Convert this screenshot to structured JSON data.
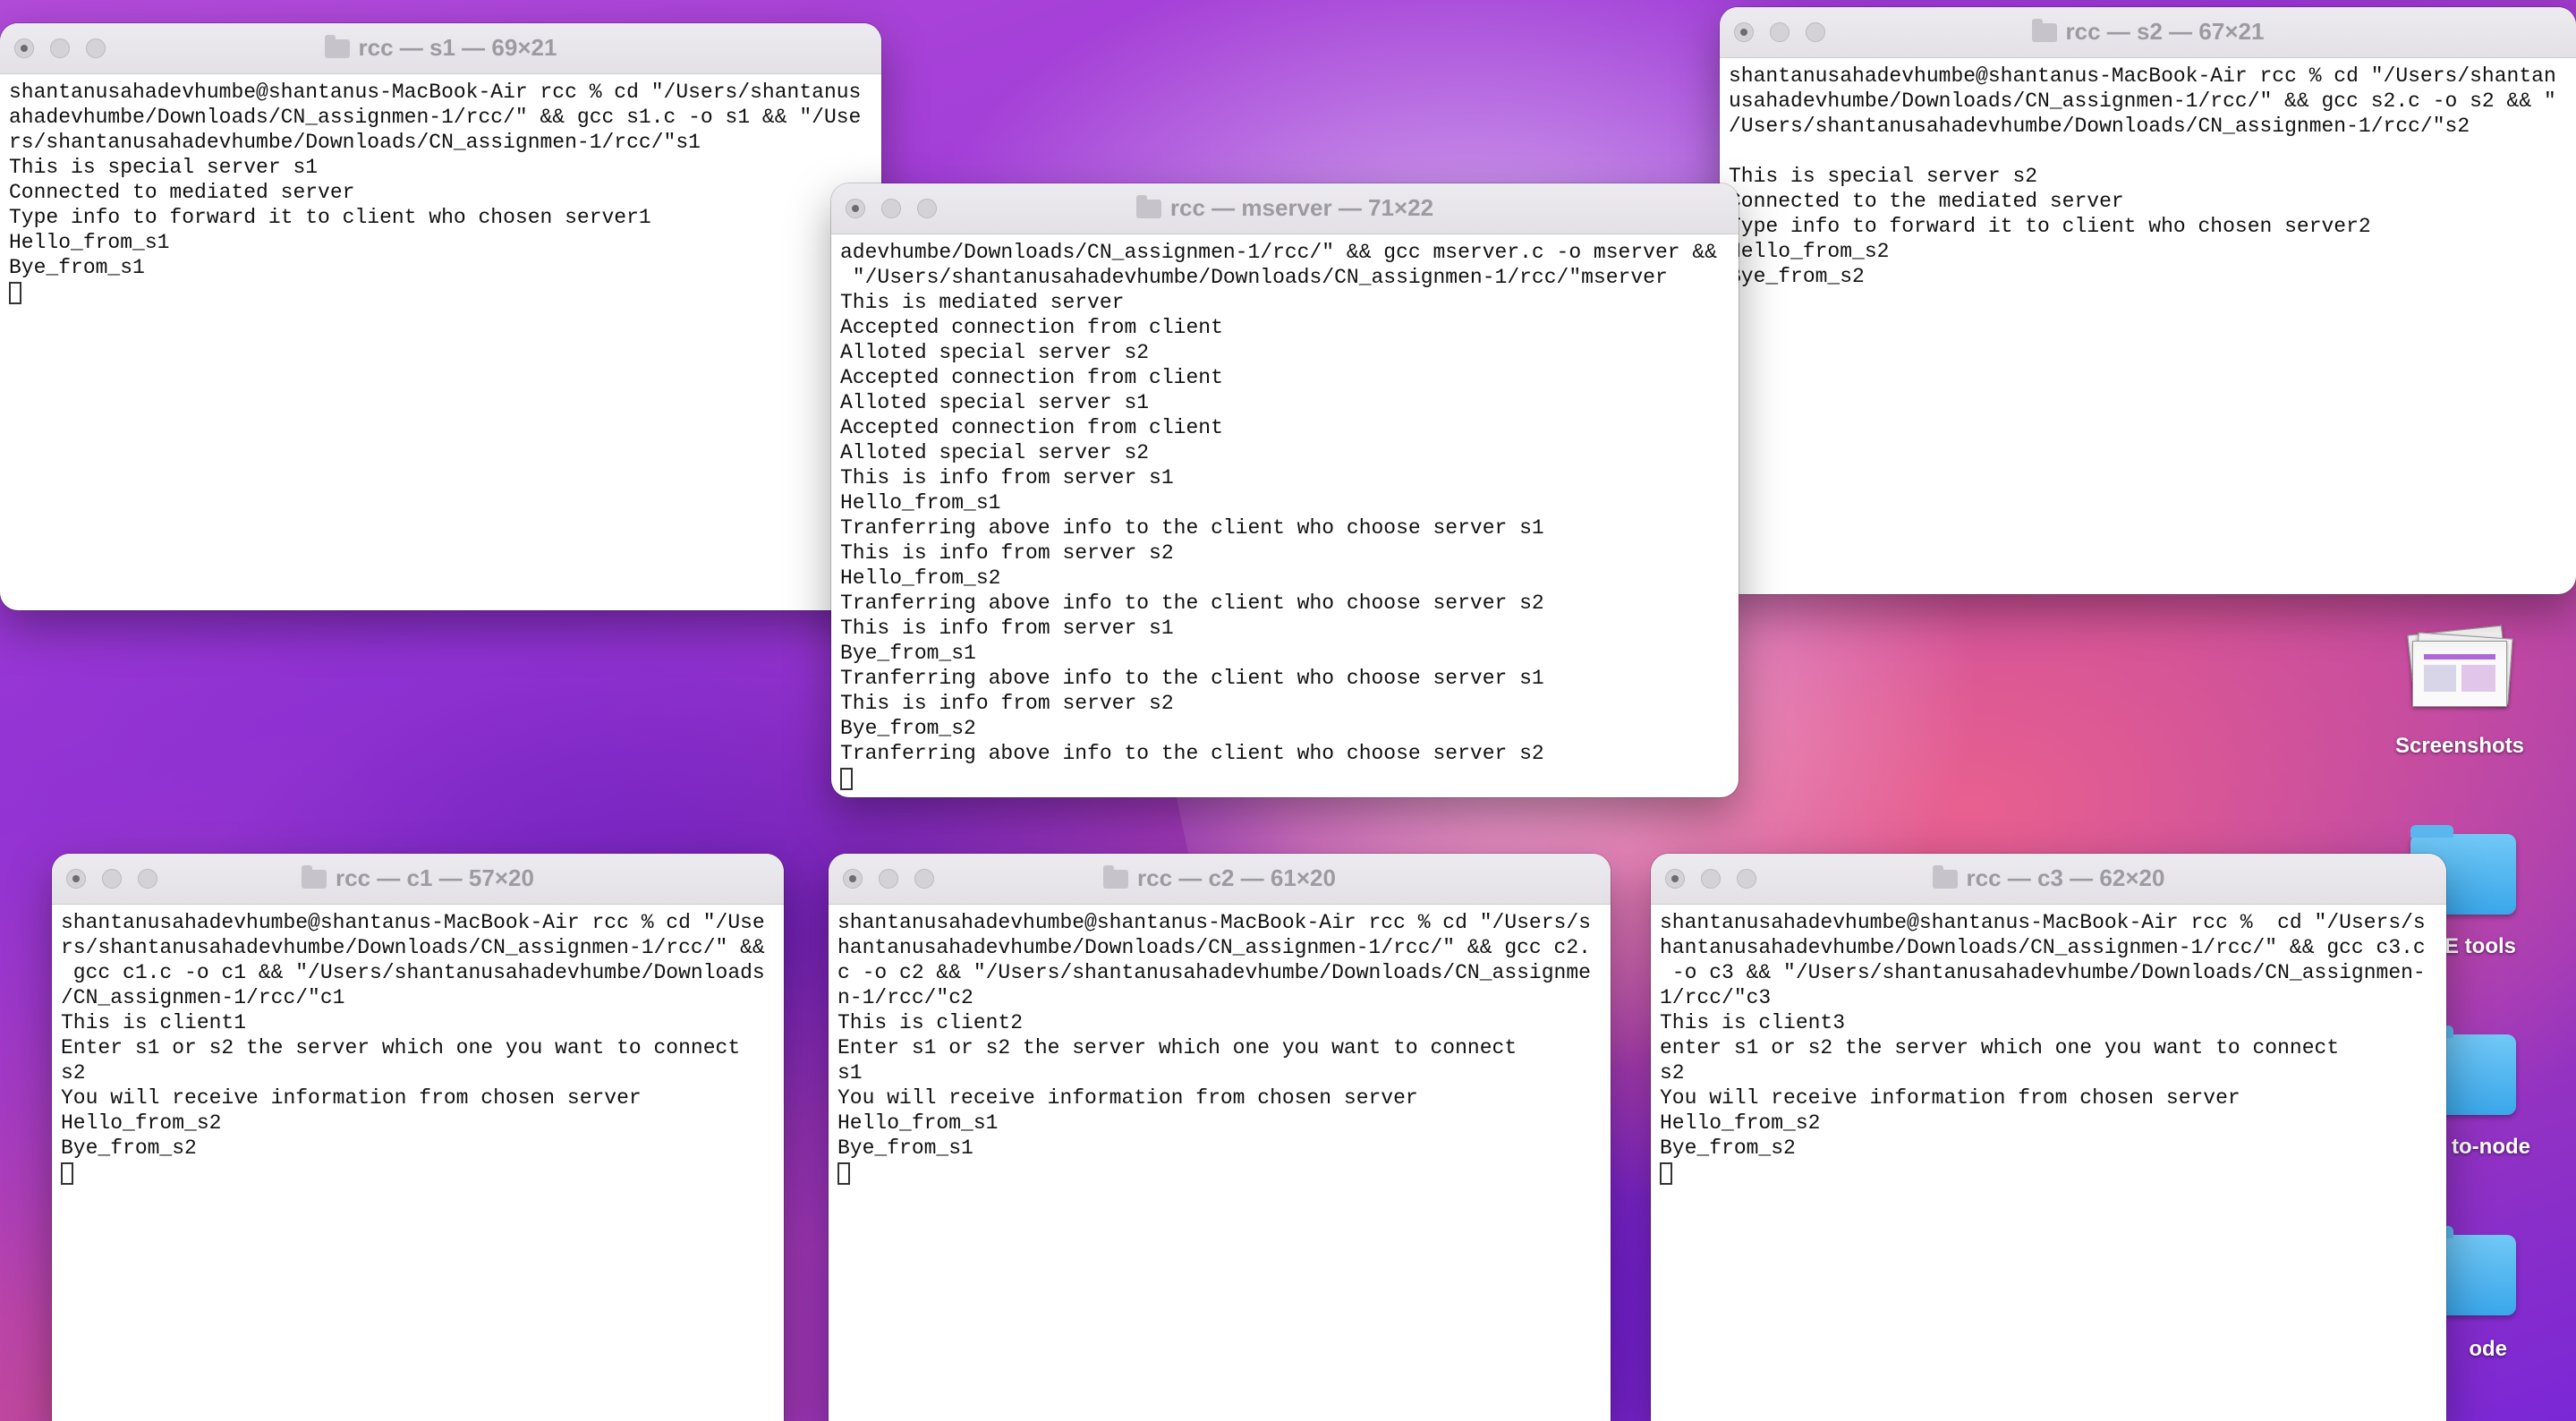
{
  "desktop": {
    "items": [
      {
        "label": "Screenshots"
      },
      {
        "label": "E tools"
      },
      {
        "label": "to-node"
      },
      {
        "label": "ode"
      }
    ]
  },
  "windows": {
    "s1": {
      "title": "rcc — s1 — 69×21",
      "text": "shantanusahadevhumbe@shantanus-MacBook-Air rcc % cd \"/Users/shantanus\nahadevhumbe/Downloads/CN_assignmen-1/rcc/\" && gcc s1.c -o s1 && \"/Use\nrs/shantanusahadevhumbe/Downloads/CN_assignmen-1/rcc/\"s1\nThis is special server s1\nConnected to mediated server\nType info to forward it to client who chosen server1\nHello_from_s1\nBye_from_s1"
    },
    "s2": {
      "title": "rcc — s2 — 67×21",
      "text": "shantanusahadevhumbe@shantanus-MacBook-Air rcc % cd \"/Users/shantan\nusahadevhumbe/Downloads/CN_assignmen-1/rcc/\" && gcc s2.c -o s2 && \"\n/Users/shantanusahadevhumbe/Downloads/CN_assignmen-1/rcc/\"s2\n\nThis is special server s2\nConnected to the mediated server\nType info to forward it to client who chosen server2\nHello_from_s2\nBye_from_s2"
    },
    "mserver": {
      "title": "rcc — mserver — 71×22",
      "text": "adevhumbe/Downloads/CN_assignmen-1/rcc/\" && gcc mserver.c -o mserver &&\n \"/Users/shantanusahadevhumbe/Downloads/CN_assignmen-1/rcc/\"mserver\nThis is mediated server\nAccepted connection from client\nAlloted special server s2\nAccepted connection from client\nAlloted special server s1\nAccepted connection from client\nAlloted special server s2\nThis is info from server s1\nHello_from_s1\nTranferring above info to the client who choose server s1\nThis is info from server s2\nHello_from_s2\nTranferring above info to the client who choose server s2\nThis is info from server s1\nBye_from_s1\nTranferring above info to the client who choose server s1\nThis is info from server s2\nBye_from_s2\nTranferring above info to the client who choose server s2"
    },
    "c1": {
      "title": "rcc — c1 — 57×20",
      "text": "shantanusahadevhumbe@shantanus-MacBook-Air rcc % cd \"/Use\nrs/shantanusahadevhumbe/Downloads/CN_assignmen-1/rcc/\" &&\n gcc c1.c -o c1 && \"/Users/shantanusahadevhumbe/Downloads\n/CN_assignmen-1/rcc/\"c1\nThis is client1\nEnter s1 or s2 the server which one you want to connect\ns2\nYou will receive information from chosen server\nHello_from_s2\nBye_from_s2"
    },
    "c2": {
      "title": "rcc — c2 — 61×20",
      "text": "shantanusahadevhumbe@shantanus-MacBook-Air rcc % cd \"/Users/s\nhantanusahadevhumbe/Downloads/CN_assignmen-1/rcc/\" && gcc c2.\nc -o c2 && \"/Users/shantanusahadevhumbe/Downloads/CN_assignme\nn-1/rcc/\"c2\nThis is client2\nEnter s1 or s2 the server which one you want to connect\ns1\nYou will receive information from chosen server\nHello_from_s1\nBye_from_s1"
    },
    "c3": {
      "title": "rcc — c3 — 62×20",
      "text": "shantanusahadevhumbe@shantanus-MacBook-Air rcc %  cd \"/Users/s\nhantanusahadevhumbe/Downloads/CN_assignmen-1/rcc/\" && gcc c3.c\n -o c3 && \"/Users/shantanusahadevhumbe/Downloads/CN_assignmen-\n1/rcc/\"c3\nThis is client3\nenter s1 or s2 the server which one you want to connect\ns2\nYou will receive information from chosen server\nHello_from_s2\nBye_from_s2"
    }
  }
}
